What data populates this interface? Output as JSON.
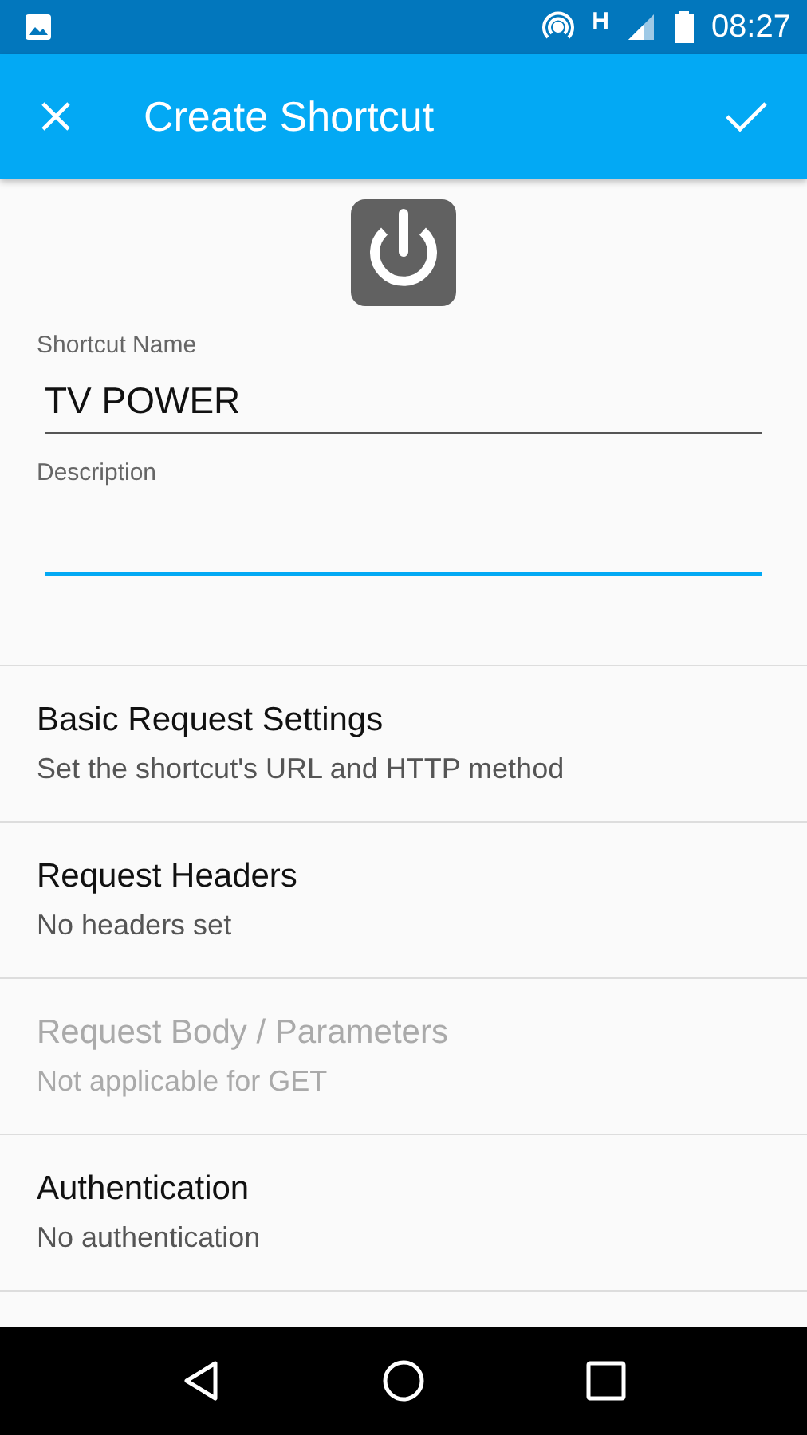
{
  "status_bar": {
    "network_type": "H",
    "time": "08:27"
  },
  "app_bar": {
    "title": "Create Shortcut"
  },
  "form": {
    "fields": [
      {
        "label": "Shortcut Name",
        "value": "TV POWER",
        "focused": false
      },
      {
        "label": "Description",
        "focused": true
      }
    ]
  },
  "sections": [
    {
      "title": "Basic Request Settings",
      "subtitle": "Set the shortcut's URL and HTTP method",
      "disabled": false
    },
    {
      "title": "Request Headers",
      "subtitle": "No headers set",
      "disabled": false
    },
    {
      "title": "Request Body / Parameters",
      "subtitle": "Not applicable for GET",
      "disabled": true
    },
    {
      "title": "Authentication",
      "subtitle": "No authentication",
      "disabled": false
    }
  ]
}
